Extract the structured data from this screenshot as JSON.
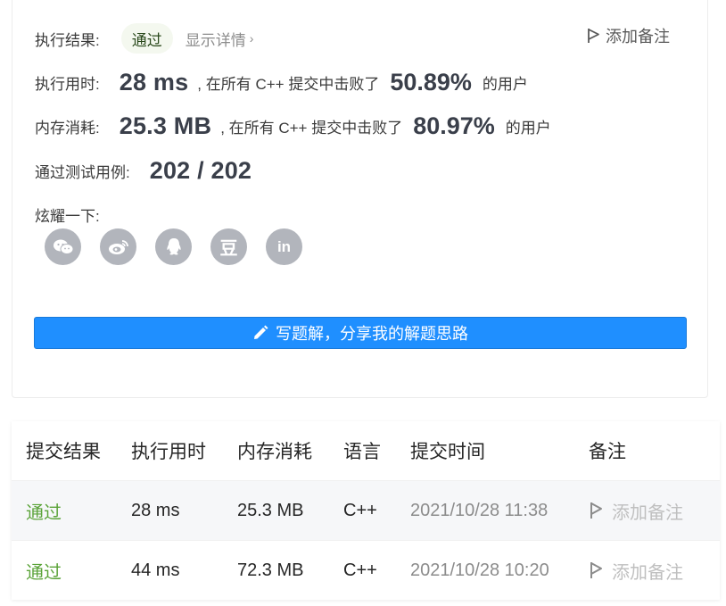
{
  "result": {
    "label": "执行结果:",
    "status": "通过",
    "detail_link": "显示详情",
    "add_note": "添加备注"
  },
  "runtime": {
    "label": "执行用时:",
    "value": "28 ms",
    "text": ", 在所有 C++ 提交中击败了",
    "percent": "50.89%",
    "suffix": "的用户"
  },
  "memory": {
    "label": "内存消耗:",
    "value": "25.3 MB",
    "text": ", 在所有 C++ 提交中击败了",
    "percent": "80.97%",
    "suffix": "的用户"
  },
  "testcases": {
    "label": "通过测试用例:",
    "value": "202 / 202"
  },
  "share": {
    "label": "炫耀一下:",
    "icons": [
      "wechat-icon",
      "weibo-icon",
      "qq-icon",
      "douban-icon",
      "linkedin-icon"
    ],
    "douban_glyph": "豆",
    "linkedin_glyph": "in"
  },
  "solution_button": "写题解，分享我的解题思路",
  "table": {
    "headers": [
      "提交结果",
      "执行用时",
      "内存消耗",
      "语言",
      "提交时间",
      "备注"
    ],
    "rows": [
      {
        "status": "通过",
        "runtime": "28 ms",
        "memory": "25.3 MB",
        "language": "C++",
        "time": "2021/10/28 11:38",
        "note": "添加备注"
      },
      {
        "status": "通过",
        "runtime": "44 ms",
        "memory": "72.3 MB",
        "language": "C++",
        "time": "2021/10/28 10:20",
        "note": "添加备注"
      }
    ]
  },
  "colors": {
    "accent": "#1f8fff",
    "success": "#5ba339",
    "icon_gray": "#b2b5bc"
  }
}
